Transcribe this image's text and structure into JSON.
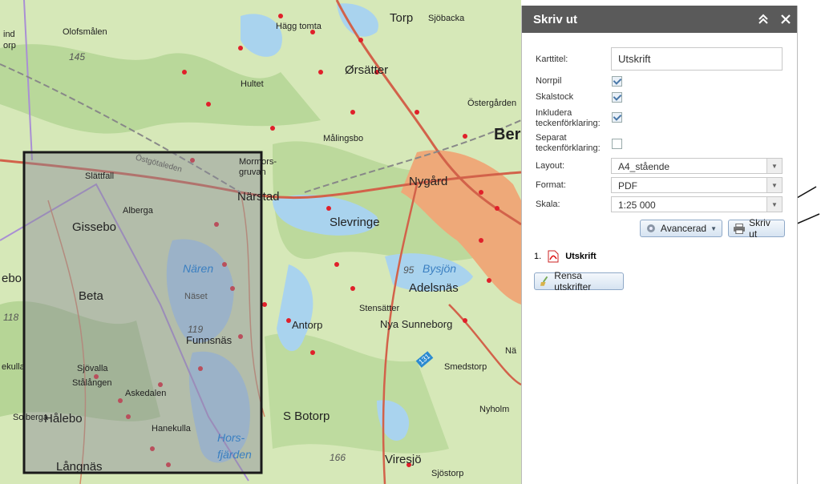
{
  "map": {
    "places": [
      {
        "text": "Olofsmålen",
        "cls": "s"
      },
      {
        "text": "Hägg tomta",
        "cls": "s"
      },
      {
        "text": "Torp",
        "cls": "l"
      },
      {
        "text": "Sjöbacka",
        "cls": "s"
      },
      {
        "text": "Ørsätter",
        "cls": "l"
      },
      {
        "text": "Hultet",
        "cls": "s"
      },
      {
        "text": "Östergården",
        "cls": "s"
      },
      {
        "text": "Ber",
        "cls": "xl"
      },
      {
        "text": "Målingsbo",
        "cls": "s"
      },
      {
        "text": "Mormors-",
        "cls": "s"
      },
      {
        "text": "gruvan",
        "cls": "s"
      },
      {
        "text": "Slättfall",
        "cls": "s"
      },
      {
        "text": "Östgötaleden",
        "cls": "s"
      },
      {
        "text": "Närstad",
        "cls": "l"
      },
      {
        "text": "Nygård",
        "cls": "l"
      },
      {
        "text": "Gissebo",
        "cls": "l"
      },
      {
        "text": "Alberga",
        "cls": "s"
      },
      {
        "text": "Slevringe",
        "cls": "l"
      },
      {
        "text": "Nären",
        "cls": "water"
      },
      {
        "text": "Näset",
        "cls": "s"
      },
      {
        "text": "Bysjön",
        "cls": "water"
      },
      {
        "text": "95",
        "cls": "elev"
      },
      {
        "text": "Adelsnäs",
        "cls": "l"
      },
      {
        "text": "Beta",
        "cls": "l"
      },
      {
        "text": "Stensätter",
        "cls": "s"
      },
      {
        "text": "Nya Sunneborg",
        "cls": "m"
      },
      {
        "text": "Antorp",
        "cls": "m"
      },
      {
        "text": "119",
        "cls": "elev"
      },
      {
        "text": "Funnsnäs",
        "cls": "m"
      },
      {
        "text": "Nä",
        "cls": "s"
      },
      {
        "text": "Smedstorp",
        "cls": "s"
      },
      {
        "text": "Sjövalla",
        "cls": "s"
      },
      {
        "text": "Stålången",
        "cls": "s"
      },
      {
        "text": "Askedalen",
        "cls": "s"
      },
      {
        "text": "Nyholm",
        "cls": "s"
      },
      {
        "text": "Solberga",
        "cls": "s"
      },
      {
        "text": "Hanekulla",
        "cls": "s"
      },
      {
        "text": "S Botorp",
        "cls": "l"
      },
      {
        "text": "Hålebo",
        "cls": "l"
      },
      {
        "text": "Hors-",
        "cls": "water"
      },
      {
        "text": "fjärden",
        "cls": "water"
      },
      {
        "text": "166",
        "cls": "elev"
      },
      {
        "text": "Viresjö",
        "cls": "l"
      },
      {
        "text": "Långnäs",
        "cls": "l"
      },
      {
        "text": "Sjöstorp",
        "cls": "s"
      },
      {
        "text": "145",
        "cls": "elev"
      },
      {
        "text": "118",
        "cls": "elev"
      },
      {
        "text": "ebo",
        "cls": "l"
      },
      {
        "text": "ekulla",
        "cls": "s"
      },
      {
        "text": "ind",
        "cls": "s"
      },
      {
        "text": "orp",
        "cls": "s"
      },
      {
        "text": "131",
        "cls": "s"
      }
    ]
  },
  "panel": {
    "title": "Skriv ut",
    "collapse_icon": "double-chevron-up-icon",
    "close_icon": "close-icon",
    "labels": {
      "karttitel": "Karttitel:",
      "norrpil": "Norrpil",
      "skalstock": "Skalstock",
      "inkludera": "Inkludera",
      "inkludera2": "teckenförklaring:",
      "separat": "Separat",
      "separat2": "teckenförklaring:",
      "layout": "Layout:",
      "format": "Format:",
      "skala": "Skala:"
    },
    "values": {
      "karttitel": "Utskrift",
      "norrpil": true,
      "skalstock": true,
      "inkludera": true,
      "separat": false,
      "layout": "A4_stående",
      "format": "PDF",
      "skala": "1:25 000"
    },
    "buttons": {
      "advanced": "Avancerad",
      "print": "Skriv ut",
      "clear": "Rensa utskrifter"
    },
    "results": [
      {
        "index": "1.",
        "name": "Utskrift",
        "icon": "pdf-icon"
      }
    ]
  }
}
